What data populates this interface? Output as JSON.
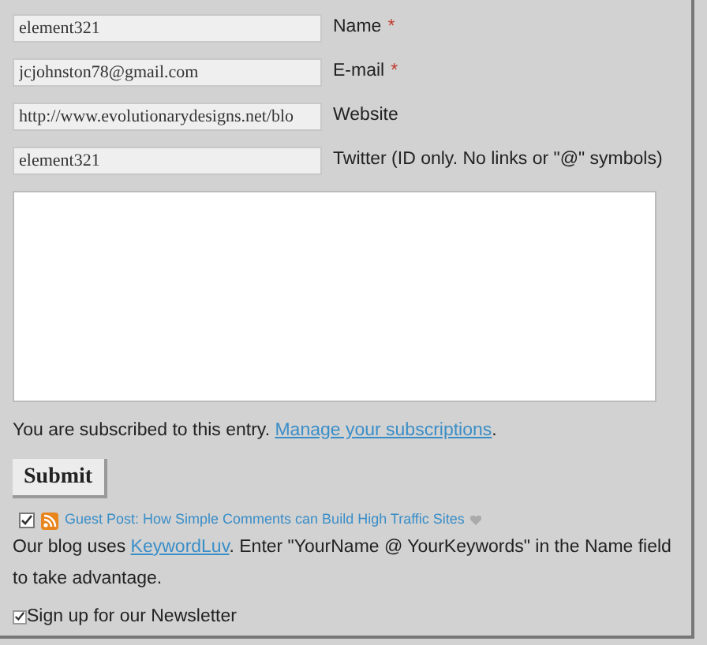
{
  "fields": [
    {
      "value": "element321",
      "label": "Name",
      "required_mark": "*"
    },
    {
      "value": "jcjohnston78@gmail.com",
      "label": "E-mail",
      "required_mark": "*"
    },
    {
      "value": "http://www.evolutionarydesigns.net/blo",
      "label": "Website"
    },
    {
      "value": "element321",
      "label": "Twitter (ID only. No links or \"@\" symbols)"
    }
  ],
  "subscription": {
    "before": "You are subscribed to this entry. ",
    "link": "Manage your subscriptions",
    "after": "."
  },
  "submit": "Submit",
  "commentluv": {
    "checked": true,
    "post_title": "Guest Post: How Simple Comments can Build High Traffic Sites"
  },
  "keywordluv": {
    "before": "Our blog uses ",
    "link": "KeywordLuv",
    "after": ". Enter \"YourName @ YourKeywords\" in the Name field to take advantage."
  },
  "newsletter": {
    "checked": true,
    "label": "Sign up for our Newsletter"
  }
}
